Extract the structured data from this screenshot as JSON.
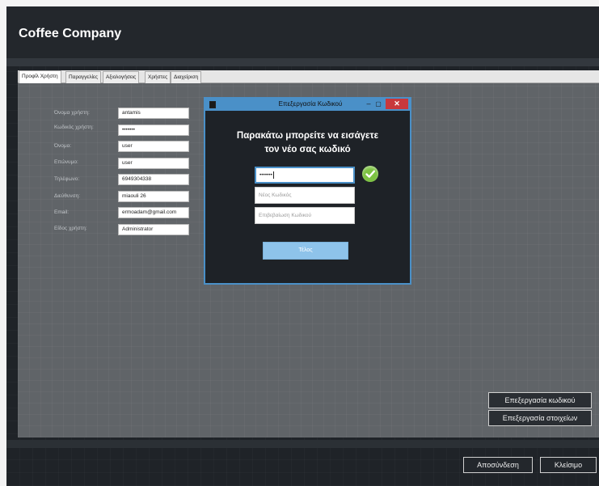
{
  "app": {
    "title": "Coffee Company"
  },
  "tabs": [
    {
      "label": "Προφίλ Χρήστη",
      "active": true
    },
    {
      "label": "Παραγγελίες",
      "active": false
    },
    {
      "label": "Αξιολογήσεις",
      "active": false
    },
    {
      "label": "Χρήστες",
      "active": false
    },
    {
      "label": "Διαχείριση",
      "active": false
    }
  ],
  "profile": {
    "fields": [
      {
        "label": "Όνομα χρήστη:",
        "value": "antamis"
      },
      {
        "label": "Κωδικός χρήστη:",
        "value": "•••••••"
      },
      {
        "label": "Όνομα:",
        "value": "user"
      },
      {
        "label": "Επώνυμο:",
        "value": "user"
      },
      {
        "label": "Τηλέφωνο:",
        "value": "6949304338"
      },
      {
        "label": "Διεύθυνση:",
        "value": "miaouli 26"
      },
      {
        "label": "Email:",
        "value": "ermoadam@gmail.com"
      },
      {
        "label": "Είδος χρήστη:",
        "value": "Administrator"
      }
    ]
  },
  "actions": {
    "edit_password": "Επεξεργασία κωδικού",
    "edit_details": "Επεξεργασία στοιχείων"
  },
  "footer": {
    "logout": "Αποσύνδεση",
    "close": "Κλείσιμο"
  },
  "dialog": {
    "title": "Επεξεργασία Κωδικού",
    "minimize_glyph": "–",
    "maximize_glyph": "▢",
    "close_glyph": "✕",
    "heading_line1": "Παρακάτω μπορείτε να εισάγετε",
    "heading_line2": "τον νέο σας κωδικό",
    "current_password_value": "•••••••",
    "new_password_placeholder": "Νέος Κωδικός",
    "confirm_password_placeholder": "Επιβεβαίωση Κωδικού",
    "submit": "Τέλος",
    "check_glyph": "✓"
  },
  "colors": {
    "accent": "#4a90c8",
    "success": "#7cc242",
    "close": "#c8383c"
  }
}
